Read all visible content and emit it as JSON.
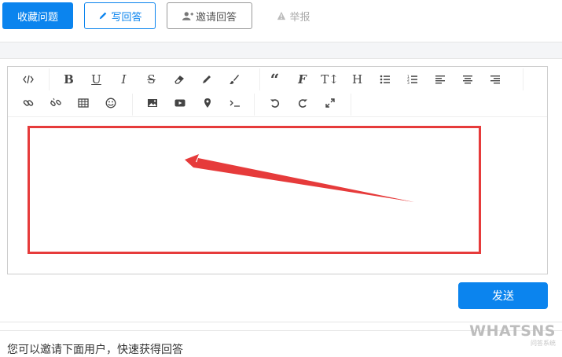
{
  "question_actions": {
    "favorite_label": "收藏问题",
    "write_answer_label": "写回答",
    "invite_answer_label": "邀请回答",
    "report_label": "举报"
  },
  "editor": {
    "toolbar_row1": [
      {
        "name": "code-icon",
        "glyph": "</>"
      },
      {
        "name": "bold-icon",
        "glyph": "B"
      },
      {
        "name": "underline-icon",
        "glyph": "U"
      },
      {
        "name": "italic-icon",
        "glyph": "I"
      },
      {
        "name": "strikethrough-icon",
        "glyph": "S"
      },
      {
        "name": "eraser-icon",
        "glyph": ""
      },
      {
        "name": "pencil-icon",
        "glyph": ""
      },
      {
        "name": "paintbrush-icon",
        "glyph": ""
      },
      {
        "name": "quote-icon",
        "glyph": "“"
      },
      {
        "name": "font-icon",
        "glyph": "F"
      },
      {
        "name": "text-height-icon",
        "glyph": "T"
      },
      {
        "name": "heading-icon",
        "glyph": "H"
      },
      {
        "name": "unordered-list-icon",
        "glyph": ""
      },
      {
        "name": "ordered-list-icon",
        "glyph": ""
      },
      {
        "name": "align-left-icon",
        "glyph": ""
      },
      {
        "name": "align-center-icon",
        "glyph": ""
      },
      {
        "name": "align-right-icon",
        "glyph": ""
      }
    ],
    "toolbar_row2": [
      {
        "name": "link-icon",
        "glyph": ""
      },
      {
        "name": "unlink-icon",
        "glyph": ""
      },
      {
        "name": "table-icon",
        "glyph": ""
      },
      {
        "name": "emoji-icon",
        "glyph": ""
      },
      {
        "name": "image-icon",
        "glyph": ""
      },
      {
        "name": "video-icon",
        "glyph": ""
      },
      {
        "name": "map-marker-icon",
        "glyph": ""
      },
      {
        "name": "terminal-icon",
        "glyph": ">_"
      },
      {
        "name": "undo-icon",
        "glyph": ""
      },
      {
        "name": "redo-icon",
        "glyph": ""
      },
      {
        "name": "fullscreen-icon",
        "glyph": ""
      }
    ],
    "content": "",
    "send_label": "发送"
  },
  "invite_section": {
    "text": "您可以邀请下面用户，快速获得回答"
  },
  "watermark": {
    "brand": "WHATSNS",
    "subtitle": "问答系统"
  },
  "colors": {
    "primary": "#0b84ee",
    "annotation_red": "#e63b3b"
  }
}
